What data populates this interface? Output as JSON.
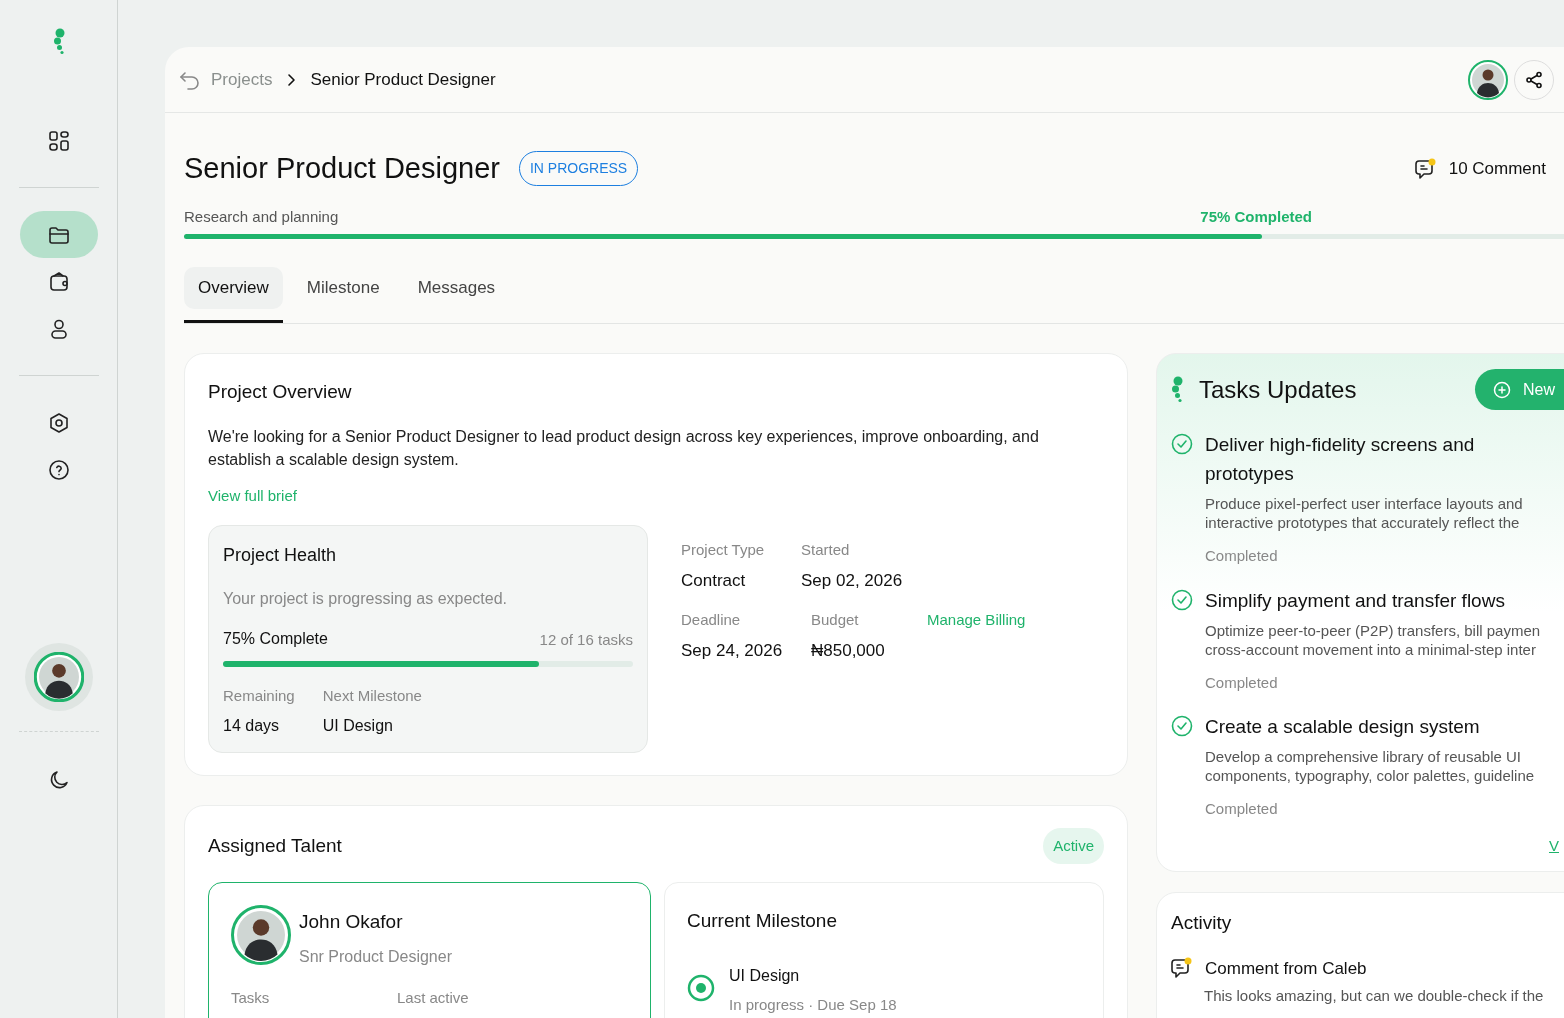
{
  "sidebar": {
    "sections": [
      {
        "items": [
          {
            "selected": false
          }
        ]
      },
      {
        "items": [
          {
            "selected": true
          },
          {
            "selected": false
          },
          {
            "selected": false
          }
        ]
      },
      {
        "items": [
          {
            "selected": false
          },
          {
            "selected": false
          }
        ]
      }
    ]
  },
  "breadcrumb": {
    "parent": "Projects",
    "current": "Senior Product Designer"
  },
  "project": {
    "title": "Senior Product Designer",
    "status": "IN PROGRESS",
    "comments": "10 Comment",
    "phase": "Research and planning",
    "progress_label": "75% Completed",
    "level": 0.75
  },
  "tabs": [
    {
      "label": "Overview",
      "selected": true
    },
    {
      "label": "Milestone",
      "selected": false
    },
    {
      "label": "Messages",
      "selected": false
    }
  ],
  "overview": {
    "title": "Project Overview",
    "description": "We're looking for a Senior Product Designer to lead product design across key experiences, improve onboarding, and establish a scalable design system.",
    "link": "View full brief"
  },
  "health": {
    "title": "Project Health",
    "message": "Your project is progressing as expected.",
    "complete_label": "75% Complete",
    "tasks_count": "12 of 16 tasks",
    "level": 0.77,
    "stats": [
      {
        "label": "Remaining",
        "value": "14 days"
      },
      {
        "label": "Next Milestone",
        "value": "UI Design"
      }
    ]
  },
  "details": [
    {
      "label": "Project Type",
      "value": "Contract"
    },
    {
      "label": "Started",
      "value": "Sep 02, 2026"
    },
    {
      "label": "Deadline",
      "value": "Sep 24, 2026"
    },
    {
      "label": "Budget",
      "value": "₦850,000"
    }
  ],
  "billing_link": "Manage Billing",
  "talent": {
    "title": "Assigned Talent",
    "badge": "Active",
    "name": "John Okafor",
    "role": "Snr Product Designer",
    "stats": [
      "Tasks",
      "Last active"
    ],
    "milestone": {
      "title": "Current Milestone",
      "name": "UI Design",
      "meta": "In progress · Due Sep 18"
    }
  },
  "tasks": {
    "title": "Tasks Updates",
    "button": "New",
    "link": "V",
    "items": [
      {
        "title": "Deliver high-fidelity screens and prototypes",
        "description": "Produce pixel-perfect user interface layouts and interactive prototypes that accurately reflect the",
        "status": "Completed",
        "checked": true
      },
      {
        "title": "Simplify payment and transfer flows",
        "description": "Optimize peer-to-peer (P2P) transfers, bill paymen cross-account movement into a minimal-step inter",
        "status": "Completed",
        "checked": true
      },
      {
        "title": "Create a scalable design system",
        "description": "Develop a comprehensive library of reusable UI components, typography, color palettes, guideline",
        "status": "Completed",
        "checked": true
      }
    ]
  },
  "activity": {
    "title": "Activity",
    "items": [
      {
        "title": "Comment from Caleb",
        "text": "This looks amazing, but can we double-check if the"
      }
    ]
  }
}
